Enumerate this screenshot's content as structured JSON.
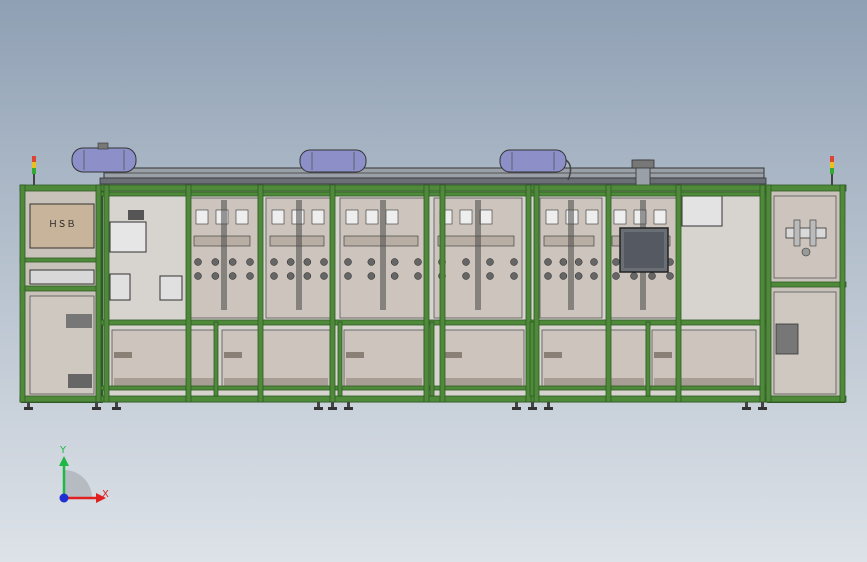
{
  "viewport": {
    "background_top": "#8fa0b4",
    "background_bottom": "#dde2e8"
  },
  "machine": {
    "frame_color": "#4e8a3a",
    "frame_dark": "#2f5a24",
    "panel_color": "#cdc5bd",
    "panel_shadow": "#a89e95",
    "tank_color": "#8c8fc8",
    "left_label": "ＨＳＢ",
    "tank_count": 3,
    "station_count": 6,
    "signal_towers": 2
  },
  "triad": {
    "y_label": "Y",
    "x_label": "X",
    "y_color": "#1eb845",
    "x_color": "#e02020",
    "z_color": "#2030d0"
  }
}
